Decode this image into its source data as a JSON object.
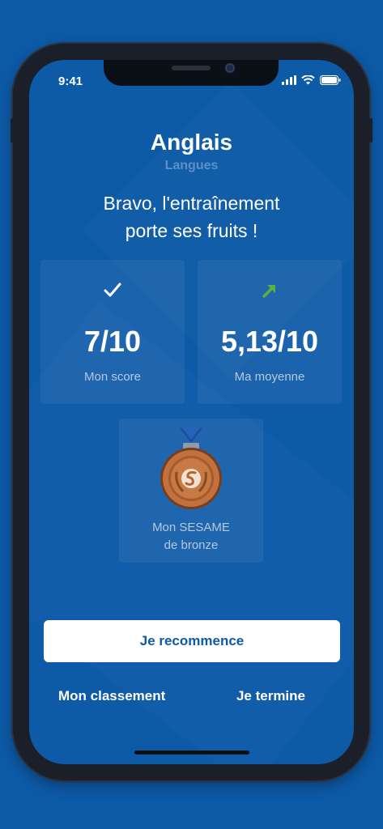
{
  "status_bar": {
    "time": "9:41"
  },
  "header": {
    "title": "Anglais",
    "subtitle": "Langues",
    "message_line1": "Bravo, l'entraînement",
    "message_line2": "porte ses fruits !"
  },
  "cards": {
    "score": {
      "icon": "checkmark-icon",
      "value": "7/10",
      "label": "Mon score"
    },
    "average": {
      "icon": "trend-up-arrow-icon",
      "value": "5,13/10",
      "label": "Ma moyenne"
    },
    "medal": {
      "icon": "bronze-medal-icon",
      "label": "Mon SESAME\nde bronze"
    }
  },
  "actions": {
    "restart_label": "Je recommence",
    "ranking_label": "Mon classement",
    "finish_label": "Je termine"
  },
  "colors": {
    "background": "#0d5aa7",
    "card": "rgba(255,255,255,0.06)",
    "accent_green": "#5cb33b",
    "bronze": "#c1713e"
  }
}
